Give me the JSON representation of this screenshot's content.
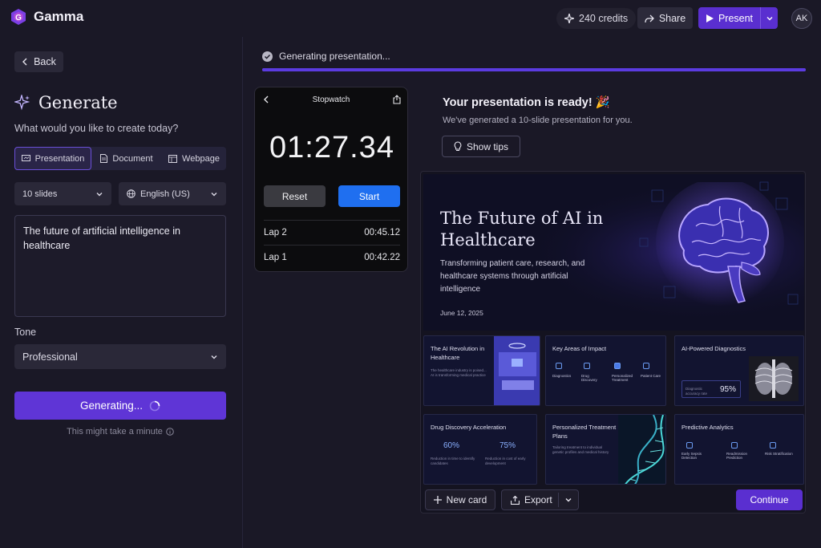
{
  "header": {
    "app_name": "Gamma",
    "credits": "240 credits",
    "share_label": "Share",
    "present_label": "Present",
    "avatar_initials": "AK"
  },
  "left": {
    "back_label": "Back",
    "title": "Generate",
    "subtitle": "What would you like to create today?",
    "tabs": [
      "Presentation",
      "Document",
      "Webpage"
    ],
    "active_tab": "Presentation",
    "slides_value": "10 slides",
    "language_value": "English (US)",
    "prompt": "The future of artificial intelligence in healthcare",
    "tone_label": "Tone",
    "tone_value": "Professional",
    "generating_label": "Generating...",
    "minute_note": "This might take a minute"
  },
  "status": {
    "text": "Generating presentation...",
    "progress": 1.0
  },
  "stopwatch": {
    "title": "Stopwatch",
    "time": "01:27.34",
    "reset_label": "Reset",
    "start_label": "Start",
    "laps": [
      {
        "name": "Lap 2",
        "time": "00:45.12"
      },
      {
        "name": "Lap 1",
        "time": "00:42.22"
      }
    ]
  },
  "ready": {
    "title": "Your presentation is ready! 🎉",
    "subtitle": "We've generated a 10-slide presentation for you.",
    "tips_label": "Show tips"
  },
  "preview": {
    "hero_title": "The Future of AI in Healthcare",
    "hero_subtitle": "Transforming patient care, research, and healthcare systems through artificial intelligence",
    "hero_date": "June 12, 2025",
    "cards": [
      {
        "title": "The AI Revolution in Healthcare",
        "text": "The healthcare industry is poised... AI is transforming medical practice"
      },
      {
        "title": "Key Areas of Impact",
        "items": [
          "Diagnostics",
          "Drug Discovery",
          "Personalized Treatment",
          "Patient Care"
        ]
      },
      {
        "title": "AI-Powered Diagnostics",
        "stat": "95%",
        "stat_caption": "Diagnostic accuracy rate"
      },
      {
        "title": "Drug Discovery Acceleration",
        "stat1": "60%",
        "stat2": "75%",
        "text1": "Reduction in time to identify candidates",
        "text2": "Reduction in cost of early development"
      },
      {
        "title": "Personalized Treatment Plans",
        "text": "Tailoring treatment to individual genetic profiles and medical history"
      },
      {
        "title": "Predictive Analytics",
        "items": [
          "Early Sepsis Detection",
          "Readmission Prediction",
          "Risk Stratification"
        ]
      }
    ],
    "new_card_label": "New card",
    "export_label": "Export",
    "continue_label": "Continue"
  },
  "colors": {
    "accent": "#5a2fd0",
    "start_button": "#1f6ff0",
    "background": "#1a1826"
  }
}
